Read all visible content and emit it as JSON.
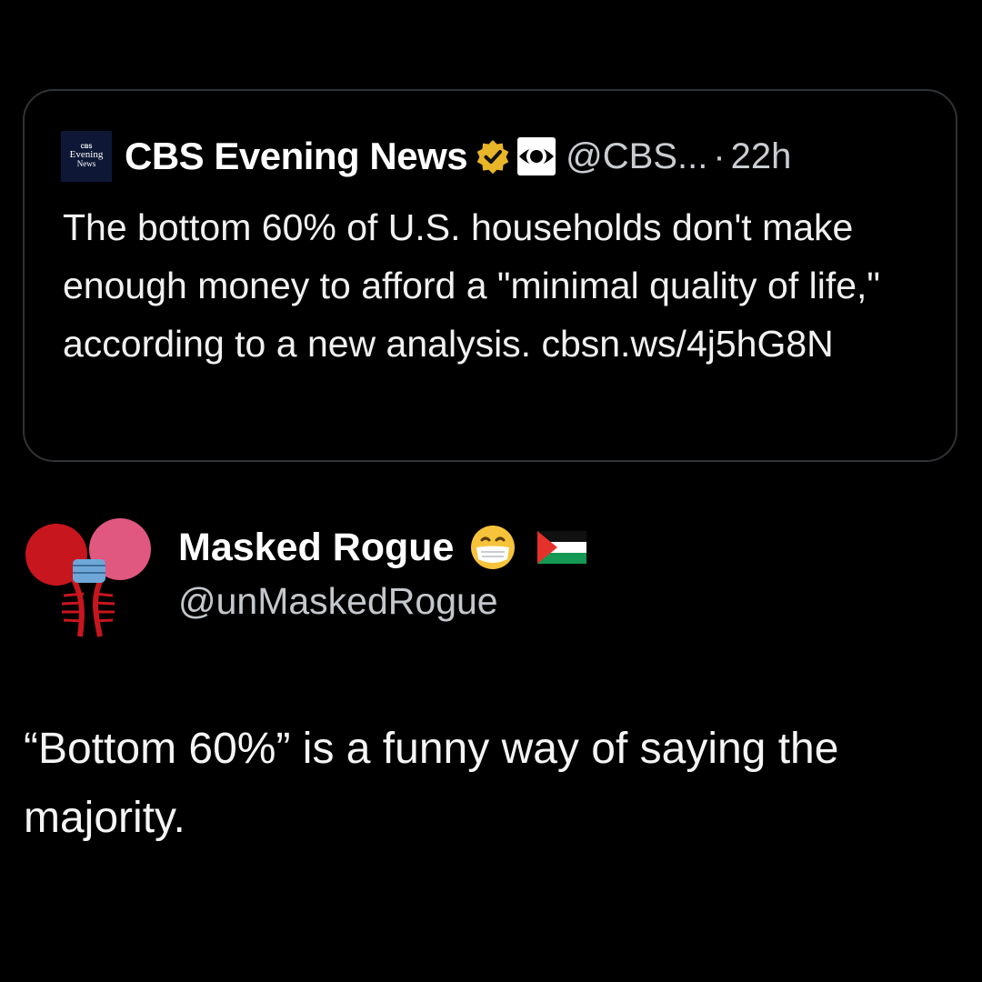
{
  "quoted_tweet": {
    "avatar_text": {
      "line1": "CBS",
      "line2": "Evening",
      "line3": "News"
    },
    "display_name": "CBS Evening News",
    "handle": "@CBS...",
    "separator": "·",
    "time": "22h",
    "text": "The bottom 60% of U.S. households don't make enough money to afford a \"minimal quality of life,\" according to a new analysis. cbsn.ws/4j5hG8N",
    "verified_badge_color": "#e8b528",
    "badges": [
      "verified-badge-icon",
      "cbs-eye-logo-icon"
    ]
  },
  "reply": {
    "display_name": "Masked Rogue",
    "name_emojis": [
      "face-with-medical-mask-icon",
      "palestine-flag-icon"
    ],
    "handle": "@unMaskedRogue",
    "text": "“Bottom 60%” is a funny way of saying the majority."
  },
  "colors": {
    "background": "#000000",
    "border": "#2f3336",
    "primary_text": "#ffffff",
    "secondary_text": "#c9ccd0"
  }
}
